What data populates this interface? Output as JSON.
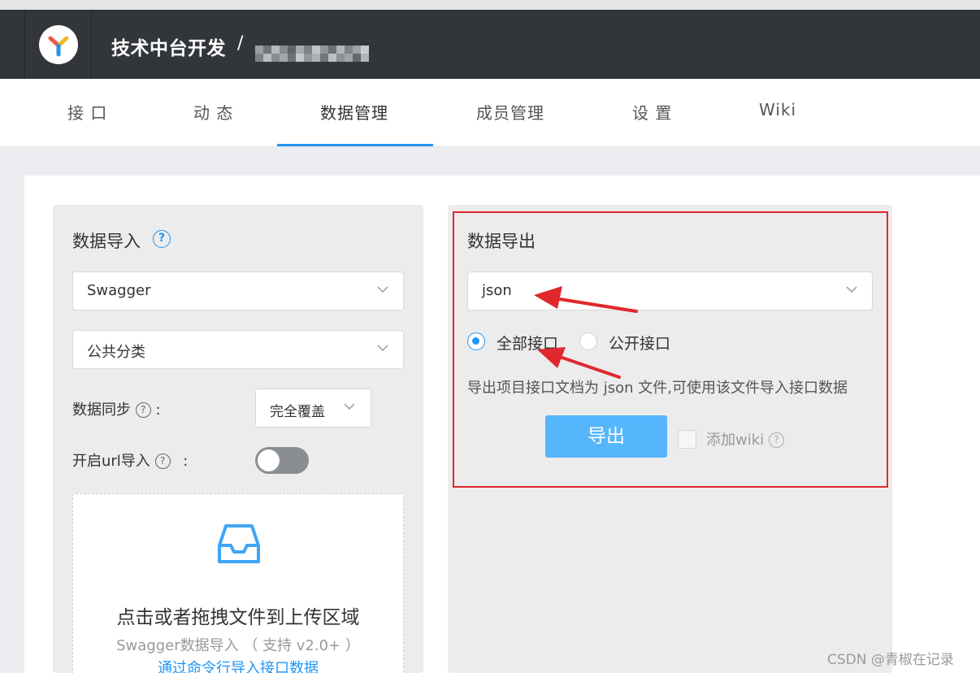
{
  "header": {
    "project_title": "技术中台开发",
    "separator": "/"
  },
  "nav": {
    "tabs": [
      {
        "label": "接 口"
      },
      {
        "label": "动 态"
      },
      {
        "label": "数据管理",
        "active": true
      },
      {
        "label": "成员管理"
      },
      {
        "label": "设 置"
      },
      {
        "label": "Wiki"
      }
    ]
  },
  "import_panel": {
    "title": "数据导入",
    "help": "?",
    "format_select": "Swagger",
    "category_select": "公共分类",
    "sync_label": "数据同步",
    "sync_colon": ":",
    "sync_select": "完全覆盖",
    "url_import_label": "开启url导入",
    "url_import_colon": ":",
    "url_import_enabled": false,
    "dropzone": {
      "title": "点击或者拖拽文件到上传区域",
      "subtitle": "Swagger数据导入 （ 支持 v2.0+ ）",
      "link": "通过命令行导入接口数据"
    }
  },
  "export_panel": {
    "title": "数据导出",
    "format_select": "json",
    "radio_all": "全部接口",
    "radio_public": "公开接口",
    "selected_radio": "全部接口",
    "description": "导出项目接口文档为 json 文件,可使用该文件导入接口数据",
    "export_button": "导出",
    "add_wiki_label": "添加wiki",
    "add_wiki_checked": false
  },
  "icons": {
    "logo": "yapi-logo-icon",
    "help": "question-circle-icon",
    "select_arrow": "chevron-down-icon",
    "upload": "inbox-icon"
  },
  "colors": {
    "header_bg": "#32363a",
    "accent": "#2395f1",
    "export_button": "#56b6fb",
    "annotation": "#e0282e"
  },
  "watermark": "CSDN @青椒在记录"
}
